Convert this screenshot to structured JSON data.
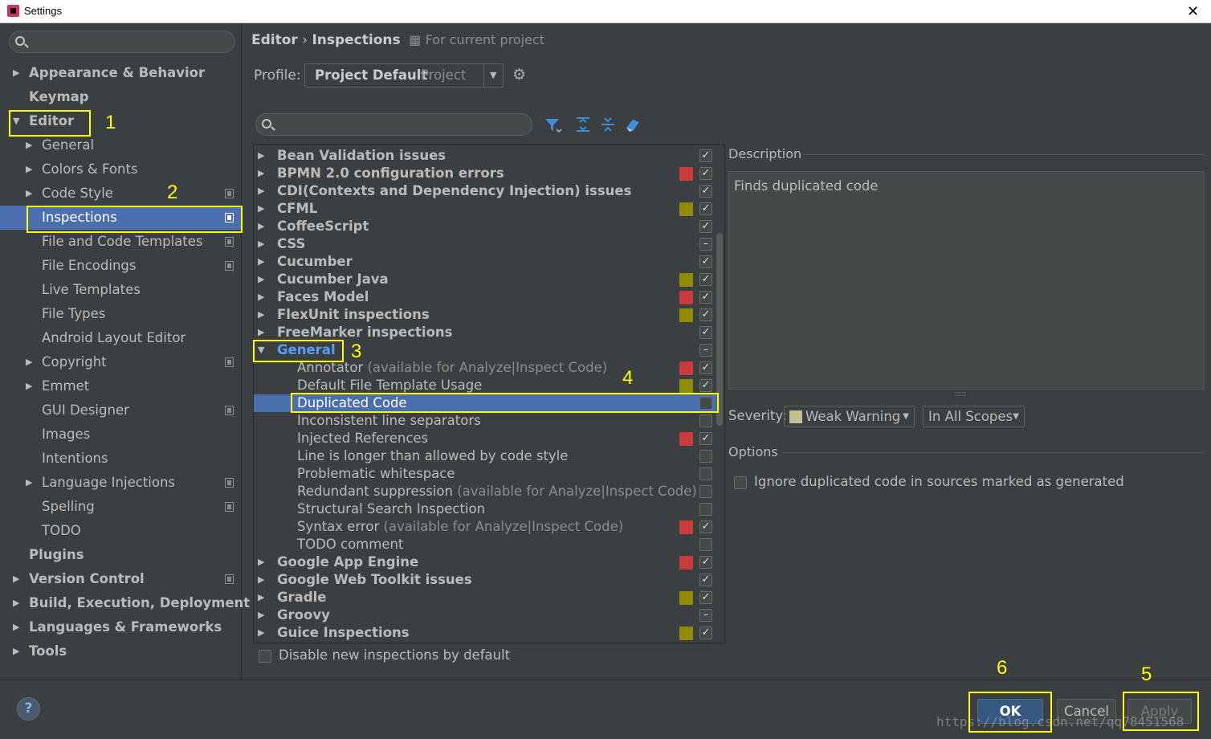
{
  "window": {
    "title": "Settings",
    "close_glyph": "✕"
  },
  "sidebar": {
    "items": [
      {
        "label": "Appearance & Behavior",
        "bold": true,
        "arrow": "▶",
        "level": 0,
        "proj": false,
        "selected": false
      },
      {
        "label": "Keymap",
        "bold": true,
        "arrow": "",
        "level": 0,
        "proj": false,
        "selected": false
      },
      {
        "label": "Editor",
        "bold": true,
        "arrow": "▼",
        "level": 0,
        "proj": false,
        "selected": false
      },
      {
        "label": "General",
        "bold": false,
        "arrow": "▶",
        "level": 1,
        "proj": false,
        "selected": false
      },
      {
        "label": "Colors & Fonts",
        "bold": false,
        "arrow": "▶",
        "level": 1,
        "proj": false,
        "selected": false
      },
      {
        "label": "Code Style",
        "bold": false,
        "arrow": "▶",
        "level": 1,
        "proj": true,
        "selected": false
      },
      {
        "label": "Inspections",
        "bold": false,
        "arrow": "",
        "level": 2,
        "proj": true,
        "selected": true
      },
      {
        "label": "File and Code Templates",
        "bold": false,
        "arrow": "",
        "level": 2,
        "proj": true,
        "selected": false
      },
      {
        "label": "File Encodings",
        "bold": false,
        "arrow": "",
        "level": 2,
        "proj": true,
        "selected": false
      },
      {
        "label": "Live Templates",
        "bold": false,
        "arrow": "",
        "level": 2,
        "proj": false,
        "selected": false
      },
      {
        "label": "File Types",
        "bold": false,
        "arrow": "",
        "level": 2,
        "proj": false,
        "selected": false
      },
      {
        "label": "Android Layout Editor",
        "bold": false,
        "arrow": "",
        "level": 2,
        "proj": false,
        "selected": false
      },
      {
        "label": "Copyright",
        "bold": false,
        "arrow": "▶",
        "level": 1,
        "proj": true,
        "selected": false
      },
      {
        "label": "Emmet",
        "bold": false,
        "arrow": "▶",
        "level": 1,
        "proj": false,
        "selected": false
      },
      {
        "label": "GUI Designer",
        "bold": false,
        "arrow": "",
        "level": 2,
        "proj": true,
        "selected": false
      },
      {
        "label": "Images",
        "bold": false,
        "arrow": "",
        "level": 2,
        "proj": false,
        "selected": false
      },
      {
        "label": "Intentions",
        "bold": false,
        "arrow": "",
        "level": 2,
        "proj": false,
        "selected": false
      },
      {
        "label": "Language Injections",
        "bold": false,
        "arrow": "▶",
        "level": 1,
        "proj": true,
        "selected": false
      },
      {
        "label": "Spelling",
        "bold": false,
        "arrow": "",
        "level": 2,
        "proj": true,
        "selected": false
      },
      {
        "label": "TODO",
        "bold": false,
        "arrow": "",
        "level": 2,
        "proj": false,
        "selected": false
      },
      {
        "label": "Plugins",
        "bold": true,
        "arrow": "",
        "level": 0,
        "proj": false,
        "selected": false
      },
      {
        "label": "Version Control",
        "bold": true,
        "arrow": "▶",
        "level": 0,
        "proj": true,
        "selected": false
      },
      {
        "label": "Build, Execution, Deployment",
        "bold": true,
        "arrow": "▶",
        "level": 0,
        "proj": false,
        "selected": false
      },
      {
        "label": "Languages & Frameworks",
        "bold": true,
        "arrow": "▶",
        "level": 0,
        "proj": false,
        "selected": false
      },
      {
        "label": "Tools",
        "bold": true,
        "arrow": "▶",
        "level": 0,
        "proj": false,
        "selected": false
      }
    ]
  },
  "breadcrumb": {
    "parent": "Editor",
    "separator": "›",
    "current": "Inspections",
    "scope_note": "For current project"
  },
  "profile": {
    "label": "Profile:",
    "name": "Project Default",
    "type": "Project",
    "dropdown_glyph": "▼",
    "gear_glyph": "⚙"
  },
  "inspections": {
    "rows": [
      {
        "label": "Bean Validation issues",
        "note": "",
        "bold": true,
        "arrow": "▶",
        "indent": 0,
        "sev": "",
        "check": "✓",
        "selected": false
      },
      {
        "label": "BPMN 2.0 configuration errors",
        "note": "",
        "bold": true,
        "arrow": "▶",
        "indent": 0,
        "sev": "#c93b3b",
        "check": "✓",
        "selected": false
      },
      {
        "label": "CDI(Contexts and Dependency Injection) issues",
        "note": "",
        "bold": true,
        "arrow": "▶",
        "indent": 0,
        "sev": "",
        "check": "✓",
        "selected": false
      },
      {
        "label": "CFML",
        "note": "",
        "bold": true,
        "arrow": "▶",
        "indent": 0,
        "sev": "#8f8c00",
        "check": "✓",
        "selected": false
      },
      {
        "label": "CoffeeScript",
        "note": "",
        "bold": true,
        "arrow": "▶",
        "indent": 0,
        "sev": "",
        "check": "✓",
        "selected": false
      },
      {
        "label": "CSS",
        "note": "",
        "bold": true,
        "arrow": "▶",
        "indent": 0,
        "sev": "",
        "check": "–",
        "selected": false
      },
      {
        "label": "Cucumber",
        "note": "",
        "bold": true,
        "arrow": "▶",
        "indent": 0,
        "sev": "",
        "check": "✓",
        "selected": false
      },
      {
        "label": "Cucumber Java",
        "note": "",
        "bold": true,
        "arrow": "▶",
        "indent": 0,
        "sev": "#8f8c00",
        "check": "✓",
        "selected": false
      },
      {
        "label": "Faces Model",
        "note": "",
        "bold": true,
        "arrow": "▶",
        "indent": 0,
        "sev": "#c93b3b",
        "check": "✓",
        "selected": false
      },
      {
        "label": "FlexUnit inspections",
        "note": "",
        "bold": true,
        "arrow": "▶",
        "indent": 0,
        "sev": "#8f8c00",
        "check": "✓",
        "selected": false
      },
      {
        "label": "FreeMarker inspections",
        "note": "",
        "bold": true,
        "arrow": "▶",
        "indent": 0,
        "sev": "",
        "check": "✓",
        "selected": false
      },
      {
        "label": "General",
        "note": "",
        "bold": true,
        "arrow": "▼",
        "indent": 0,
        "sev": "",
        "check": "–",
        "selected": false,
        "general": true
      },
      {
        "label": "Annotator",
        "note": "(available for Analyze|Inspect Code)",
        "bold": false,
        "arrow": "",
        "indent": 1,
        "sev": "#c93b3b",
        "check": "✓",
        "selected": false
      },
      {
        "label": "Default File Template Usage",
        "note": "",
        "bold": false,
        "arrow": "",
        "indent": 1,
        "sev": "#8f8c00",
        "check": "✓",
        "selected": false
      },
      {
        "label": "Duplicated Code",
        "note": "",
        "bold": false,
        "arrow": "",
        "indent": 1,
        "sev": "",
        "check": "",
        "selected": true
      },
      {
        "label": "Inconsistent line separators",
        "note": "",
        "bold": false,
        "arrow": "",
        "indent": 1,
        "sev": "",
        "check": "",
        "selected": false
      },
      {
        "label": "Injected References",
        "note": "",
        "bold": false,
        "arrow": "",
        "indent": 1,
        "sev": "#c93b3b",
        "check": "✓",
        "selected": false
      },
      {
        "label": "Line is longer than allowed by code style",
        "note": "",
        "bold": false,
        "arrow": "",
        "indent": 1,
        "sev": "",
        "check": "",
        "selected": false
      },
      {
        "label": "Problematic whitespace",
        "note": "",
        "bold": false,
        "arrow": "",
        "indent": 1,
        "sev": "",
        "check": "",
        "selected": false
      },
      {
        "label": "Redundant suppression",
        "note": "(available for Analyze|Inspect Code)",
        "bold": false,
        "arrow": "",
        "indent": 1,
        "sev": "",
        "check": "",
        "selected": false
      },
      {
        "label": "Structural Search Inspection",
        "note": "",
        "bold": false,
        "arrow": "",
        "indent": 1,
        "sev": "",
        "check": "",
        "selected": false
      },
      {
        "label": "Syntax error",
        "note": "(available for Analyze|Inspect Code)",
        "bold": false,
        "arrow": "",
        "indent": 1,
        "sev": "#c93b3b",
        "check": "✓",
        "selected": false
      },
      {
        "label": "TODO comment",
        "note": "",
        "bold": false,
        "arrow": "",
        "indent": 1,
        "sev": "",
        "check": "",
        "selected": false
      },
      {
        "label": "Google App Engine",
        "note": "",
        "bold": true,
        "arrow": "▶",
        "indent": 0,
        "sev": "#c93b3b",
        "check": "✓",
        "selected": false
      },
      {
        "label": "Google Web Toolkit issues",
        "note": "",
        "bold": true,
        "arrow": "▶",
        "indent": 0,
        "sev": "",
        "check": "✓",
        "selected": false
      },
      {
        "label": "Gradle",
        "note": "",
        "bold": true,
        "arrow": "▶",
        "indent": 0,
        "sev": "#8f8c00",
        "check": "✓",
        "selected": false
      },
      {
        "label": "Groovy",
        "note": "",
        "bold": true,
        "arrow": "▶",
        "indent": 0,
        "sev": "",
        "check": "–",
        "selected": false
      },
      {
        "label": "Guice Inspections",
        "note": "",
        "bold": true,
        "arrow": "▶",
        "indent": 0,
        "sev": "#8f8c00",
        "check": "✓",
        "selected": false
      }
    ],
    "disable_new_label": "Disable new inspections by default"
  },
  "description": {
    "title": "Description",
    "text": "Finds duplicated code",
    "grip": "::::::",
    "severity_label": "Severity:",
    "severity_value": "Weak Warning",
    "severity_swatch": "#c5c08e",
    "scope_value": "In All Scopes",
    "dropdown_glyph": "▼",
    "options_title": "Options",
    "ignore_label": "Ignore duplicated code in sources marked as generated"
  },
  "footer": {
    "help": "?",
    "ok": "OK",
    "cancel": "Cancel",
    "apply": "Apply",
    "watermark": "https://blog.csdn.net/qq78451568"
  },
  "annotations": {
    "n1": "1",
    "n2": "2",
    "n3": "3",
    "n4": "4",
    "n5": "5",
    "n6": "6"
  },
  "colors": {
    "accent": "#4b6eaf",
    "highlight": "#ffff00",
    "error": "#c93b3b",
    "warning": "#8f8c00"
  }
}
